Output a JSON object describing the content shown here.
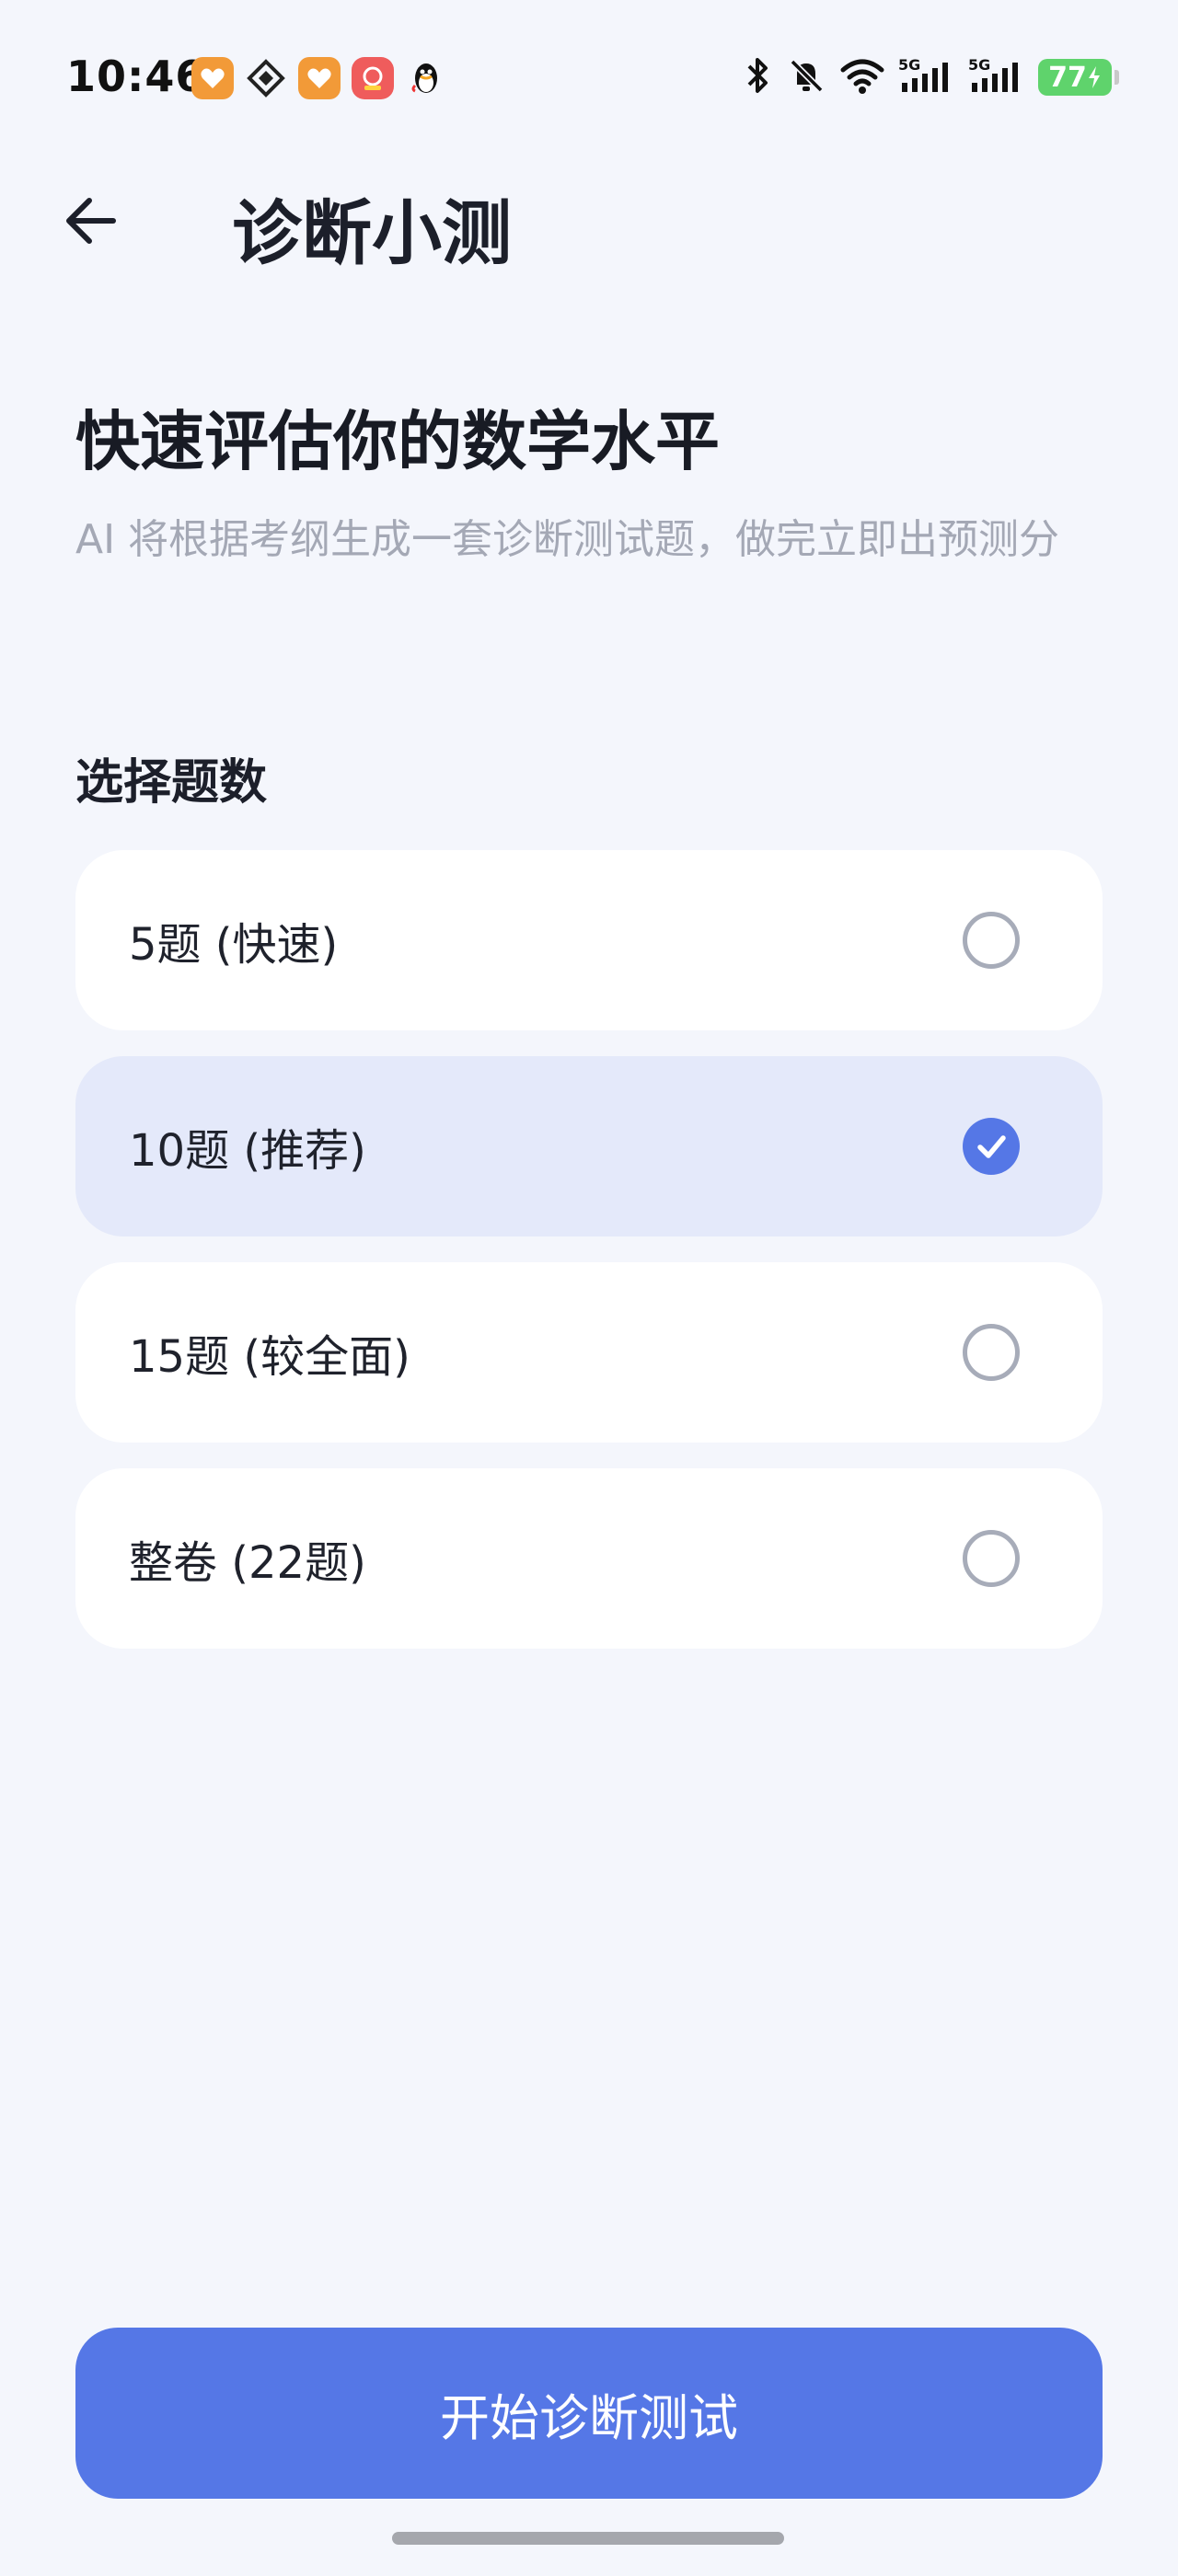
{
  "status_bar": {
    "time": "10:46",
    "battery": "77",
    "notification_icons": [
      "orange-heart-app-icon",
      "diamond-grid-app-icon",
      "orange-heart-app-icon",
      "red-shopping-app-icon",
      "penguin-app-icon"
    ],
    "system_icons": [
      "bluetooth-icon",
      "mute-bell-icon",
      "wifi-icon",
      "5g-signal-icon",
      "5g-signal-icon"
    ]
  },
  "header": {
    "title": "诊断小测"
  },
  "intro": {
    "heading": "快速评估你的数学水平",
    "description": "AI 将根据考纲生成一套诊断测试题，做完立即出预测分"
  },
  "selection": {
    "label": "选择题数",
    "options": [
      {
        "label": "5题 (快速)",
        "selected": false
      },
      {
        "label": "10题 (推荐)",
        "selected": true
      },
      {
        "label": "15题 (较全面)",
        "selected": false
      },
      {
        "label": "整卷 (22题)",
        "selected": false
      }
    ]
  },
  "action": {
    "start_label": "开始诊断测试"
  },
  "colors": {
    "accent": "#5577e6",
    "selected_bg": "#e4e9fa",
    "page_bg": "#f4f6fc",
    "battery": "#5fd36c"
  }
}
